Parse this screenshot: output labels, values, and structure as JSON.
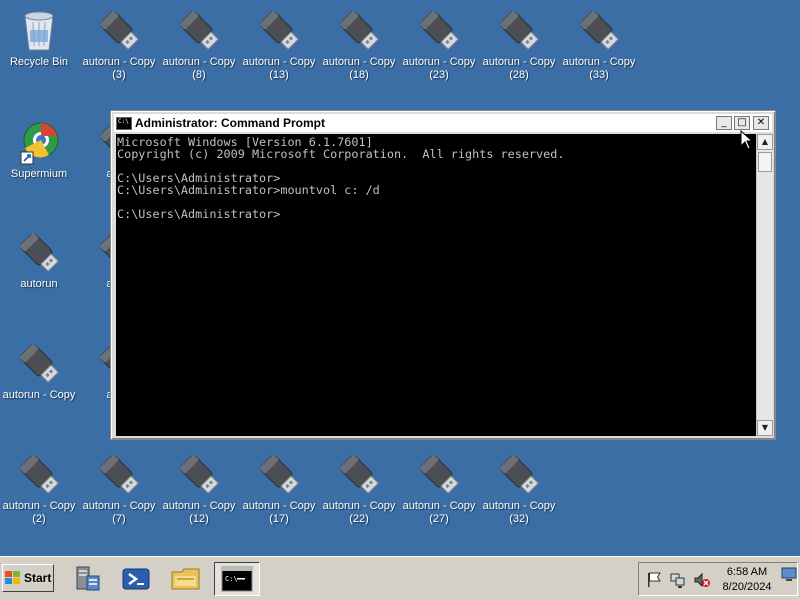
{
  "desktop": {
    "icons": [
      {
        "name": "recycle-bin",
        "label": "Recycle Bin",
        "type": "recycle",
        "col": 0,
        "row": 0
      },
      {
        "name": "autorun-copy-3",
        "label": "autorun - Copy\n(3)",
        "type": "usb",
        "col": 1,
        "row": 0
      },
      {
        "name": "autorun-copy-8",
        "label": "autorun - Copy\n(8)",
        "type": "usb",
        "col": 2,
        "row": 0
      },
      {
        "name": "autorun-copy-13",
        "label": "autorun - Copy\n(13)",
        "type": "usb",
        "col": 3,
        "row": 0
      },
      {
        "name": "autorun-copy-18",
        "label": "autorun - Copy\n(18)",
        "type": "usb",
        "col": 4,
        "row": 0
      },
      {
        "name": "autorun-copy-23",
        "label": "autorun - Copy\n(23)",
        "type": "usb",
        "col": 5,
        "row": 0
      },
      {
        "name": "autorun-copy-28",
        "label": "autorun - Copy\n(28)",
        "type": "usb",
        "col": 6,
        "row": 0
      },
      {
        "name": "autorun-copy-33",
        "label": "autorun - Copy\n(33)",
        "type": "usb",
        "col": 7,
        "row": 0
      },
      {
        "name": "supermium",
        "label": "Supermium",
        "type": "browser",
        "col": 0,
        "row": 1
      },
      {
        "name": "autorun-copy-partial-1",
        "label": "autor",
        "type": "usb",
        "col": 1,
        "row": 1
      },
      {
        "name": "autorun",
        "label": "autorun",
        "type": "usb",
        "col": 0,
        "row": 2
      },
      {
        "name": "autorun-copy-partial-2",
        "label": "autor",
        "type": "usb",
        "col": 1,
        "row": 2
      },
      {
        "name": "autorun-copy",
        "label": "autorun - Copy",
        "type": "usb",
        "col": 0,
        "row": 3
      },
      {
        "name": "autorun-copy-partial-3",
        "label": "autor",
        "type": "usb",
        "col": 1,
        "row": 3
      },
      {
        "name": "autorun-copy-2",
        "label": "autorun - Copy\n(2)",
        "type": "usb",
        "col": 0,
        "row": 4
      },
      {
        "name": "autorun-copy-7",
        "label": "autorun - Copy\n(7)",
        "type": "usb",
        "col": 1,
        "row": 4
      },
      {
        "name": "autorun-copy-12",
        "label": "autorun - Copy\n(12)",
        "type": "usb",
        "col": 2,
        "row": 4
      },
      {
        "name": "autorun-copy-17",
        "label": "autorun - Copy\n(17)",
        "type": "usb",
        "col": 3,
        "row": 4
      },
      {
        "name": "autorun-copy-22",
        "label": "autorun - Copy\n(22)",
        "type": "usb",
        "col": 4,
        "row": 4
      },
      {
        "name": "autorun-copy-27",
        "label": "autorun - Copy\n(27)",
        "type": "usb",
        "col": 5,
        "row": 4
      },
      {
        "name": "autorun-copy-32",
        "label": "autorun - Copy\n(32)",
        "type": "usb",
        "col": 6,
        "row": 4
      }
    ]
  },
  "window": {
    "title": "Administrator: Command Prompt",
    "minimize_glyph": "_",
    "maximize_glyph": "□",
    "close_glyph": "✕",
    "console_lines": [
      "Microsoft Windows [Version 6.1.7601]",
      "Copyright (c) 2009 Microsoft Corporation.  All rights reserved.",
      "",
      "C:\\Users\\Administrator>",
      "C:\\Users\\Administrator>mountvol c: /d",
      "",
      "C:\\Users\\Administrator>"
    ],
    "scroll_up_glyph": "▲",
    "scroll_down_glyph": "▼"
  },
  "taskbar": {
    "start_label": "Start",
    "pinned": [
      "server-manager-icon",
      "powershell-icon",
      "explorer-folder-icon",
      "command-prompt-icon"
    ],
    "clock_time": "6:58 AM",
    "clock_date": "8/20/2024"
  },
  "colors": {
    "desktop_bg": "#3a6ea5",
    "console_bg": "#000000",
    "console_fg": "#c0c0c0",
    "taskbar_bg": "#d4d0c8"
  }
}
